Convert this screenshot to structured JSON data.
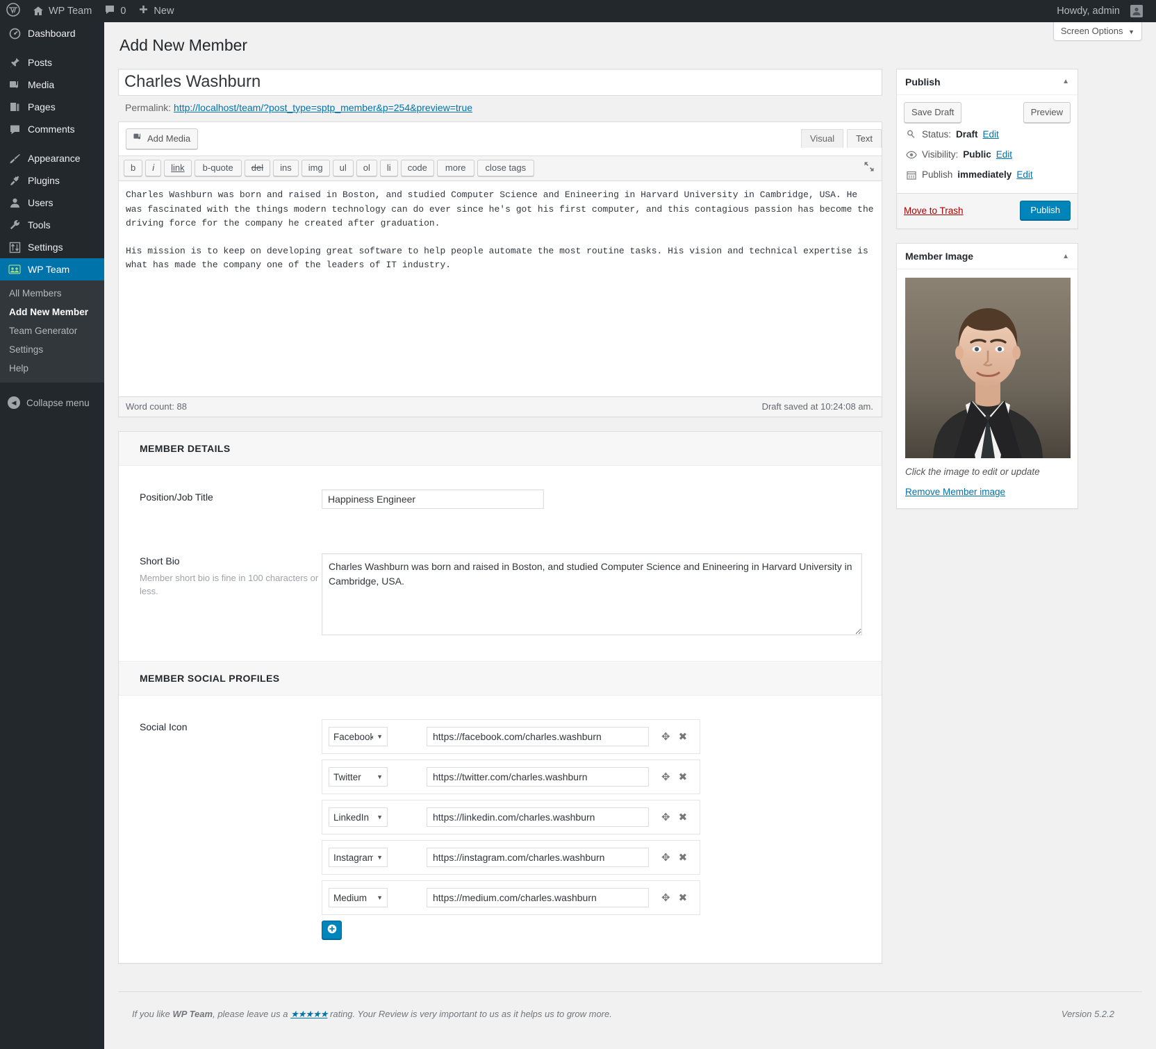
{
  "adminbar": {
    "wp_logo_icon": "wordpress-logo-icon",
    "site_home_icon": "home-icon",
    "site_name": "WP Team",
    "comments_icon": "comment-bubble-icon",
    "comments_count": "0",
    "new_icon": "plus-icon",
    "new_label": "New",
    "howdy": "Howdy, admin",
    "avatar_icon": "user-avatar-icon"
  },
  "sidebar": {
    "items": [
      {
        "label": "Dashboard",
        "icon": "dashboard-icon",
        "current": false
      },
      {
        "label": "Posts",
        "icon": "pin-icon",
        "current": false
      },
      {
        "label": "Media",
        "icon": "media-icon",
        "current": false
      },
      {
        "label": "Pages",
        "icon": "pages-icon",
        "current": false
      },
      {
        "label": "Comments",
        "icon": "comment-bubble-icon",
        "current": false
      },
      {
        "label": "Appearance",
        "icon": "paintbrush-icon",
        "current": false
      },
      {
        "label": "Plugins",
        "icon": "plug-icon",
        "current": false
      },
      {
        "label": "Users",
        "icon": "user-icon",
        "current": false
      },
      {
        "label": "Tools",
        "icon": "wrench-icon",
        "current": false
      },
      {
        "label": "Settings",
        "icon": "sliders-icon",
        "current": false
      },
      {
        "label": "WP Team",
        "icon": "team-group-icon",
        "current": true
      }
    ],
    "submenu": [
      {
        "label": "All Members",
        "current": false
      },
      {
        "label": "Add New Member",
        "current": true
      },
      {
        "label": "Team Generator",
        "current": false
      },
      {
        "label": "Settings",
        "current": false
      },
      {
        "label": "Help",
        "current": false
      }
    ],
    "collapse_label": "Collapse menu",
    "collapse_icon": "chevron-left-circle-icon"
  },
  "screen_options": {
    "label": "Screen Options",
    "caret_icon": "chevron-down-icon"
  },
  "page": {
    "title": "Add New Member"
  },
  "post": {
    "title_value": "Charles Washburn",
    "permalink_label": "Permalink:",
    "permalink_url": "http://localhost/team/?post_type=sptp_member&p=254&preview=true",
    "add_media_label": "Add Media",
    "add_media_icon": "media-add-icon",
    "tabs": [
      {
        "label": "Visual",
        "active": false
      },
      {
        "label": "Text",
        "active": true
      }
    ],
    "quicktags": [
      "b",
      "i",
      "link",
      "b-quote",
      "del",
      "ins",
      "img",
      "ul",
      "ol",
      "li",
      "code",
      "more",
      "close tags"
    ],
    "dfw_icon": "fullscreen-icon",
    "content": "Charles Washburn was born and raised in Boston, and studied Computer Science and Enineering in Harvard University in Cambridge, USA. He was fascinated with the things modern technology can do ever since he's got his first computer, and this contagious passion has become the driving force for the company he created after graduation.\n\nHis mission is to keep on developing great software to help people automate the most routine tasks. His vision and technical expertise is what has made the company one of the leaders of IT industry.",
    "word_count_label": "Word count: 88",
    "draft_saved": "Draft saved at 10:24:08 am."
  },
  "member_details": {
    "section_title": "MEMBER DETAILS",
    "position_label": "Position/Job Title",
    "position_value": "Happiness Engineer",
    "bio_label": "Short Bio",
    "bio_desc": "Member short bio is fine in 100 characters or less.",
    "bio_value": "Charles Washburn was born and raised in Boston, and studied Computer Science and Enineering in Harvard University in Cambridge, USA."
  },
  "social_profiles": {
    "section_title": "MEMBER SOCIAL PROFILES",
    "field_label": "Social Icon",
    "move_icon": "move-handle-icon",
    "remove_icon": "close-x-icon",
    "add_icon": "plus-circle-icon",
    "rows": [
      {
        "network": "Facebook",
        "url": "https://facebook.com/charles.washburn"
      },
      {
        "network": "Twitter",
        "url": "https://twitter.com/charles.washburn"
      },
      {
        "network": "LinkedIn",
        "url": "https://linkedin.com/charles.washburn"
      },
      {
        "network": "Instagram",
        "url": "https://instagram.com/charles.washburn"
      },
      {
        "network": "Medium",
        "url": "https://medium.com/charles.washburn"
      }
    ]
  },
  "publish_box": {
    "title": "Publish",
    "toggle_icon": "chevron-up-icon",
    "save_draft_label": "Save Draft",
    "preview_label": "Preview",
    "status_icon": "key-icon",
    "status_prefix": "Status:",
    "status_value": "Draft",
    "status_edit": "Edit",
    "visibility_icon": "eye-icon",
    "visibility_prefix": "Visibility:",
    "visibility_value": "Public",
    "visibility_edit": "Edit",
    "schedule_icon": "calendar-icon",
    "schedule_prefix": "Publish",
    "schedule_value": "immediately",
    "schedule_edit": "Edit",
    "trash_label": "Move to Trash",
    "publish_label": "Publish"
  },
  "member_image_box": {
    "title": "Member Image",
    "toggle_icon": "chevron-up-icon",
    "photo_icon": "member-portrait-photo",
    "hint": "Click the image to edit or update",
    "remove_label": "Remove Member image"
  },
  "footer": {
    "text_before": "If you like ",
    "brand": "WP Team",
    "text_mid": ", please leave us a ",
    "stars": "★★★★★",
    "text_after": " rating. Your Review is very important to us as it helps us to grow more.",
    "version": "Version 5.2.2"
  },
  "colors": {
    "admin_bg": "#23282d",
    "submenu_bg": "#32373c",
    "accent": "#0073aa",
    "primary_btn": "#0085ba",
    "body_bg": "#f1f1f1"
  }
}
